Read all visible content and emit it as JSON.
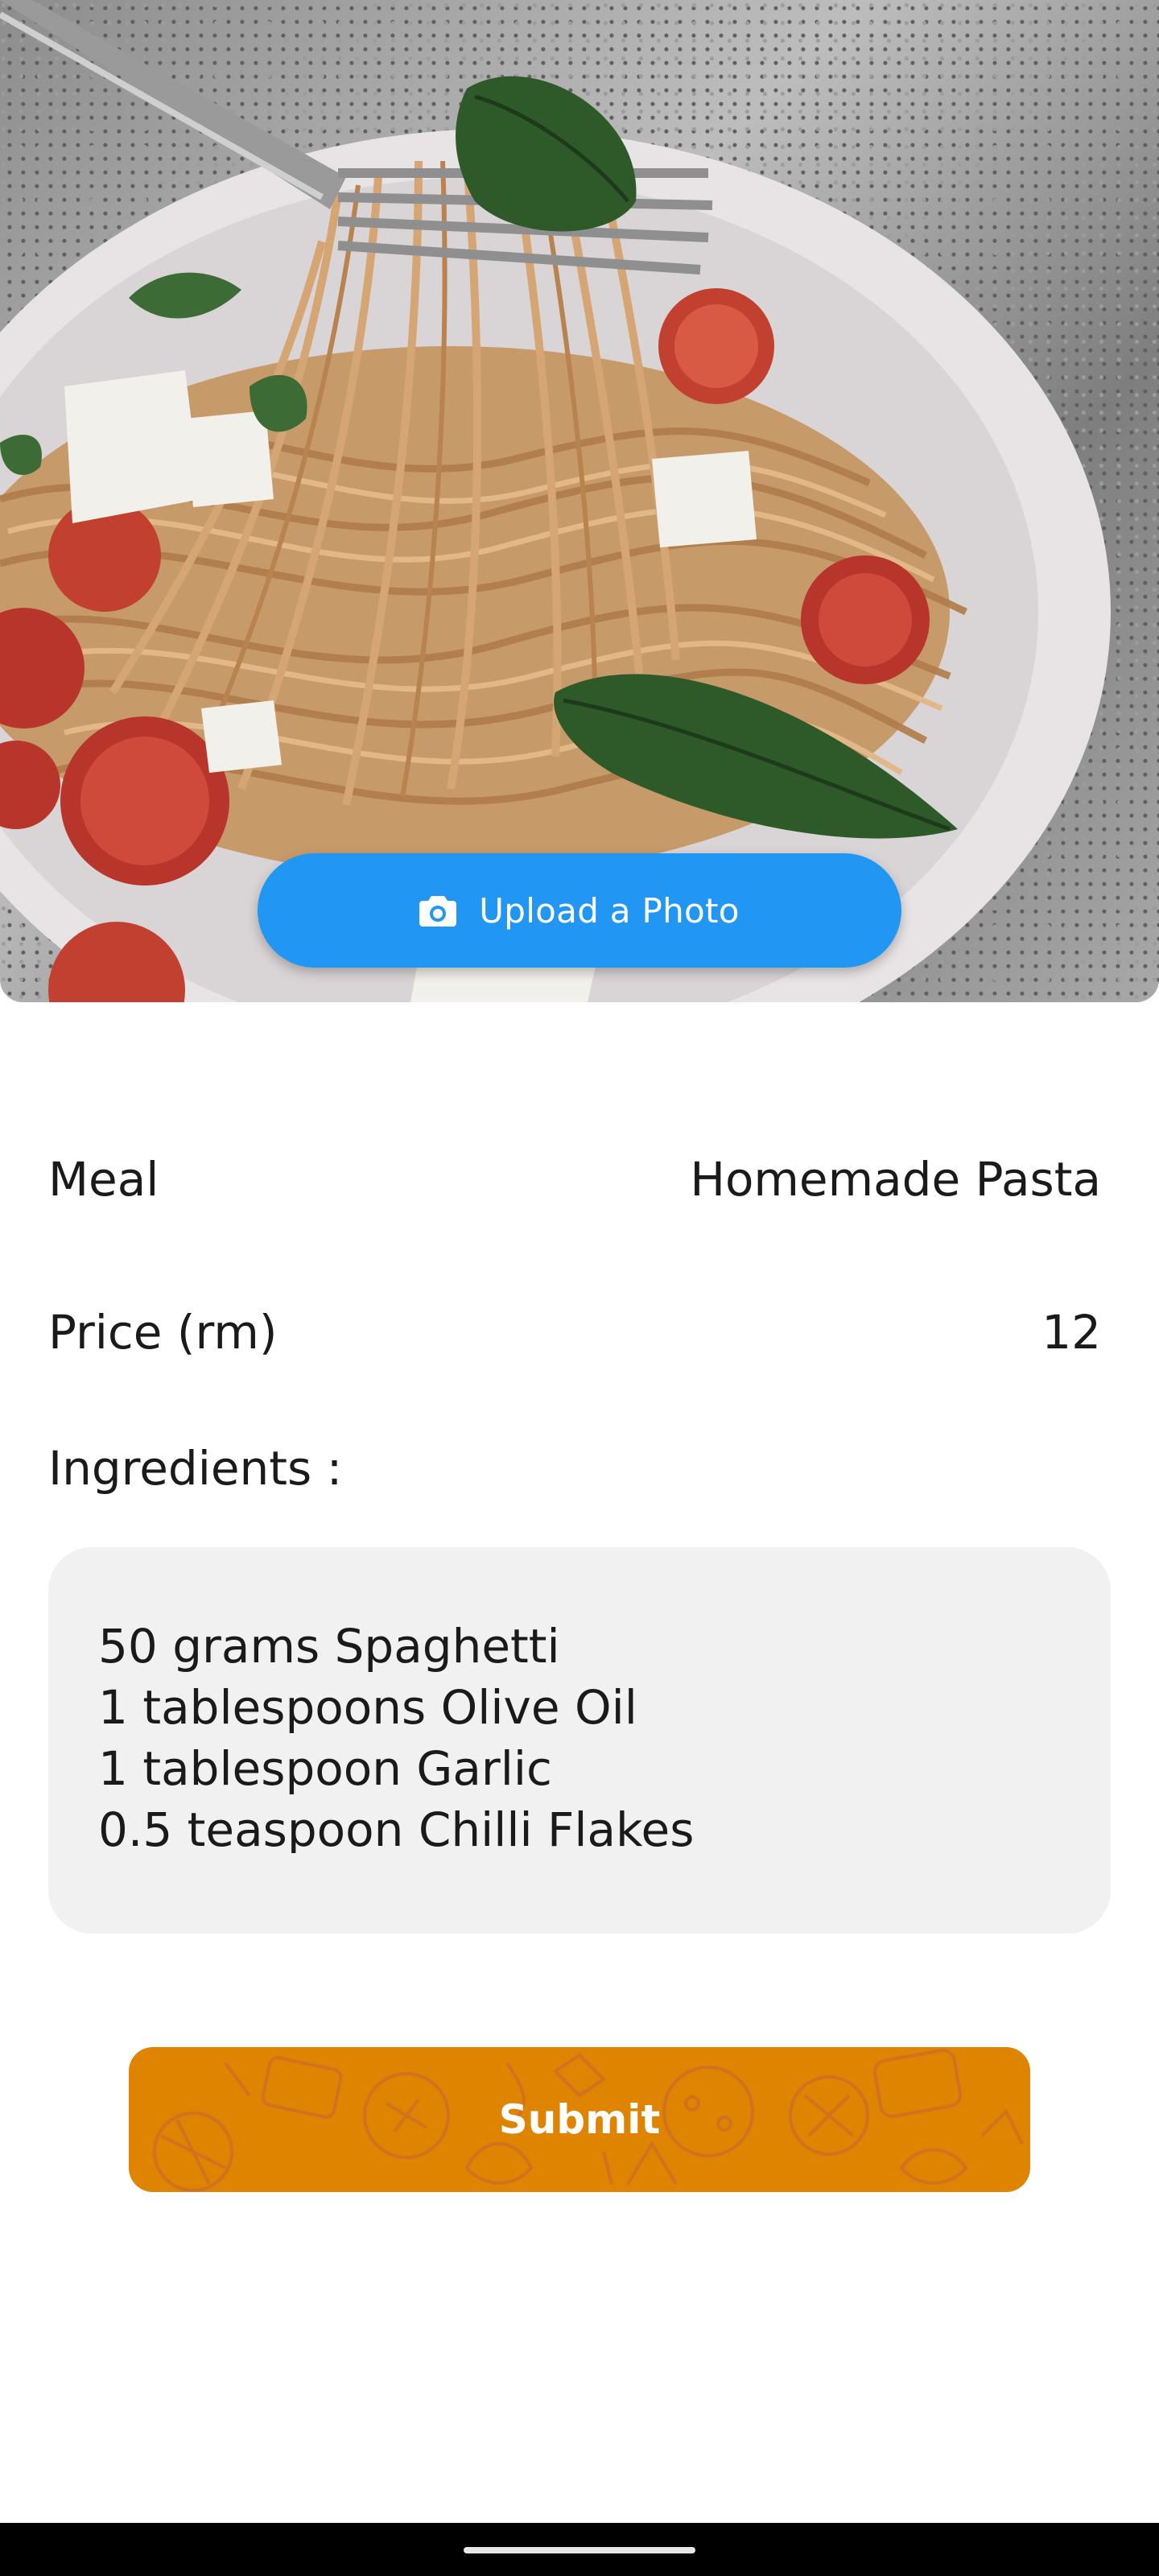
{
  "hero": {
    "photo_subject": "spaghetti with cherry tomatoes and basil twirled on a fork",
    "upload_button_label": "Upload a Photo",
    "upload_icon": "camera-icon"
  },
  "form": {
    "meal_label": "Meal",
    "meal_value": "Homemade Pasta",
    "price_label": "Price (rm)",
    "price_value": "12",
    "ingredients_label": "Ingredients :",
    "ingredients": [
      "50 grams Spaghetti",
      "1 tablespoons Olive Oil",
      "1 tablespoon Garlic",
      "0.5 teaspoon Chilli Flakes"
    ]
  },
  "submit": {
    "label": "Submit"
  },
  "colors": {
    "upload_button": "#2196f3",
    "submit_button": "#de8400",
    "ingredients_box": "#f1f1f1",
    "nav_bar": "#000000"
  }
}
